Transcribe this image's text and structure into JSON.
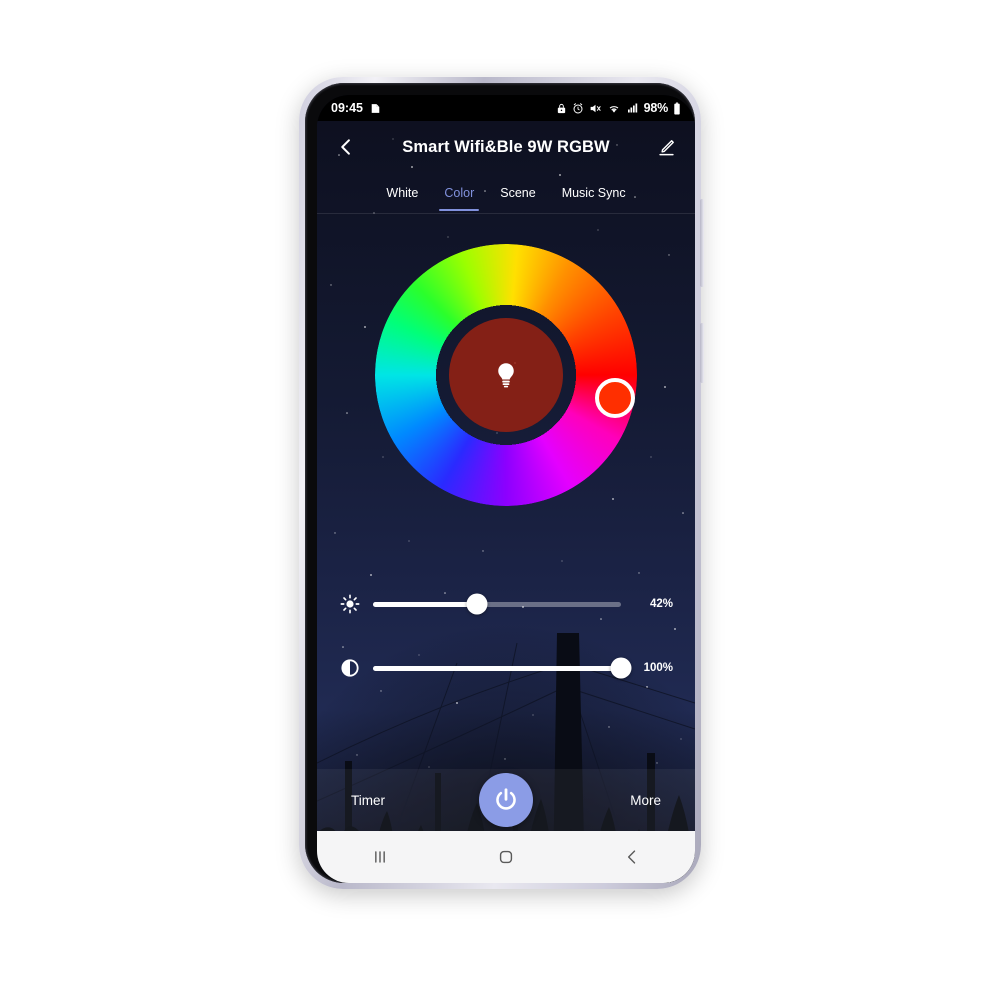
{
  "status_bar": {
    "time": "09:45",
    "notification_icon": "app-notification-icon",
    "icons": [
      "lock-icon",
      "alarm-icon",
      "mute-icon",
      "wifi-icon",
      "signal-icon"
    ],
    "battery_percent": "98%",
    "battery_icon": "battery-icon"
  },
  "title_bar": {
    "back_icon": "chevron-left-icon",
    "title": "Smart Wifi&Ble 9W RGBW",
    "edit_icon": "pencil-edit-icon"
  },
  "tabs": [
    {
      "label": "White",
      "active": false
    },
    {
      "label": "Color",
      "active": true
    },
    {
      "label": "Scene",
      "active": false
    },
    {
      "label": "Music Sync",
      "active": false
    }
  ],
  "color_wheel": {
    "center_icon": "light-bulb-icon",
    "selected_color": "#ff2f00",
    "inner_color": "#962212",
    "handle_angle_deg": 12
  },
  "sliders": [
    {
      "name": "brightness",
      "icon": "sun-brightness-icon",
      "value": 42,
      "value_label": "42%"
    },
    {
      "name": "saturation",
      "icon": "contrast-half-circle-icon",
      "value": 100,
      "value_label": "100%"
    }
  ],
  "bottom_bar": {
    "timer_label": "Timer",
    "power_icon": "power-icon",
    "power_color": "#8b9ce6",
    "more_label": "More"
  },
  "nav_bar": {
    "recents_icon": "recents-bars-icon",
    "home_icon": "home-square-icon",
    "back_icon": "back-chevron-icon"
  },
  "theme": {
    "accent": "#8191dd",
    "background": "#141a33",
    "text": "#ffffff"
  }
}
